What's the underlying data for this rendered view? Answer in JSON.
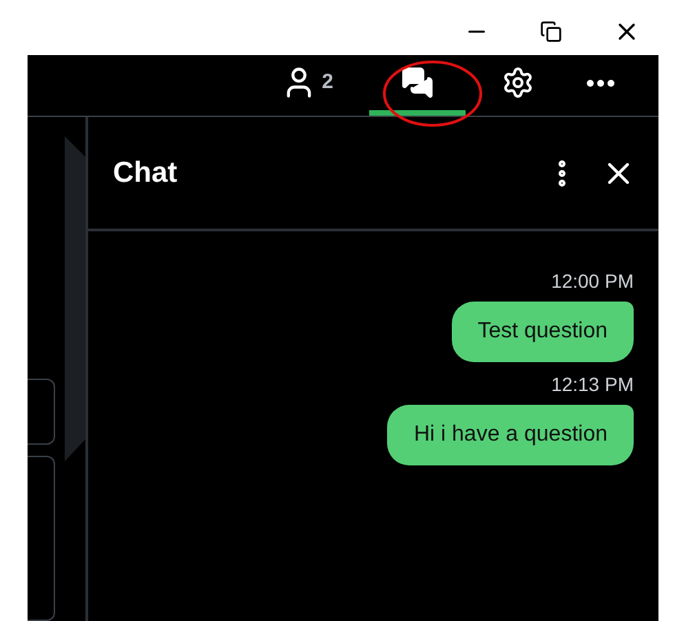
{
  "toolbar": {
    "items": [
      {
        "kind": "participants",
        "count": "2",
        "selected": false
      },
      {
        "kind": "chat",
        "selected": true
      },
      {
        "kind": "settings",
        "selected": false
      },
      {
        "kind": "more",
        "selected": false
      }
    ]
  },
  "chat": {
    "title": "Chat",
    "messages": [
      {
        "time": "12:00 PM",
        "text": "Test question"
      },
      {
        "time": "12:13 PM",
        "text": "Hi i have a question"
      }
    ]
  }
}
